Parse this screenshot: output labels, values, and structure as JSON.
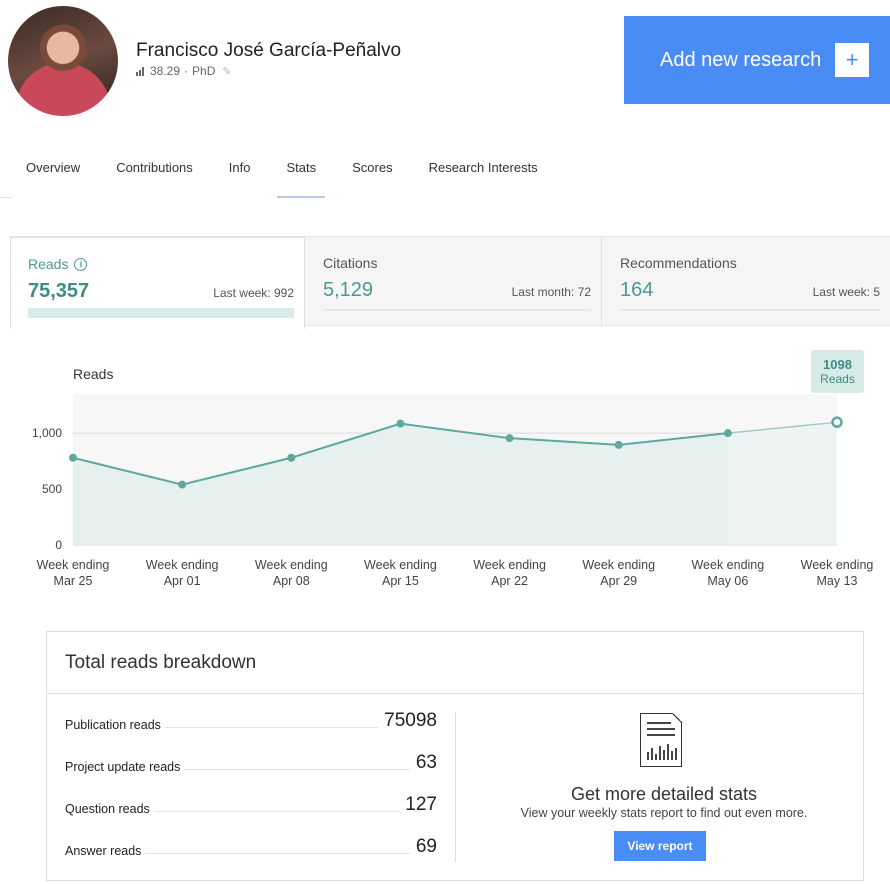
{
  "profile": {
    "name": "Francisco José García-Peñalvo",
    "score": "38.29",
    "degree": "PhD"
  },
  "add_research": {
    "label": "Add new research",
    "icon": "plus-icon"
  },
  "tabs": [
    {
      "label": "Overview"
    },
    {
      "label": "Contributions"
    },
    {
      "label": "Info"
    },
    {
      "label": "Stats",
      "active": true
    },
    {
      "label": "Scores"
    },
    {
      "label": "Research Interests"
    }
  ],
  "stat_cards": [
    {
      "label": "Reads",
      "value": "75,357",
      "sub": "Last week: 992",
      "active": true
    },
    {
      "label": "Citations",
      "value": "5,129",
      "sub": "Last month: 72"
    },
    {
      "label": "Recommendations",
      "value": "164",
      "sub": "Last week: 5"
    }
  ],
  "chart": {
    "title": "Reads",
    "tooltip": {
      "value": "1098",
      "label": "Reads"
    }
  },
  "chart_data": {
    "type": "area",
    "title": "Reads",
    "categories": [
      "Week ending Mar 25",
      "Week ending Apr 01",
      "Week ending Apr 08",
      "Week ending Apr 15",
      "Week ending Apr 22",
      "Week ending Apr 29",
      "Week ending May 06",
      "Week ending May 13"
    ],
    "series": [
      {
        "values": [
          780,
          540,
          780,
          1085,
          955,
          895,
          1000,
          1098
        ]
      }
    ],
    "yticks": [
      "1,000",
      "500",
      "0"
    ],
    "ylim": [
      0,
      1350
    ],
    "grid": true,
    "legend": "none",
    "colors": {
      "line": "#5ea8a0",
      "fill": "#e6f1ef",
      "last_fill": "#eef4f3"
    }
  },
  "breakdown": {
    "title": "Total reads breakdown",
    "rows": [
      {
        "label": "Publication reads",
        "value": "75098"
      },
      {
        "label": "Project update reads",
        "value": "63"
      },
      {
        "label": "Question reads",
        "value": "127"
      },
      {
        "label": "Answer reads",
        "value": "69"
      }
    ],
    "promo_title": "Get more detailed stats",
    "promo_sub": "View your weekly stats report to find out even more.",
    "button": "View report",
    "icon": "report-icon"
  }
}
